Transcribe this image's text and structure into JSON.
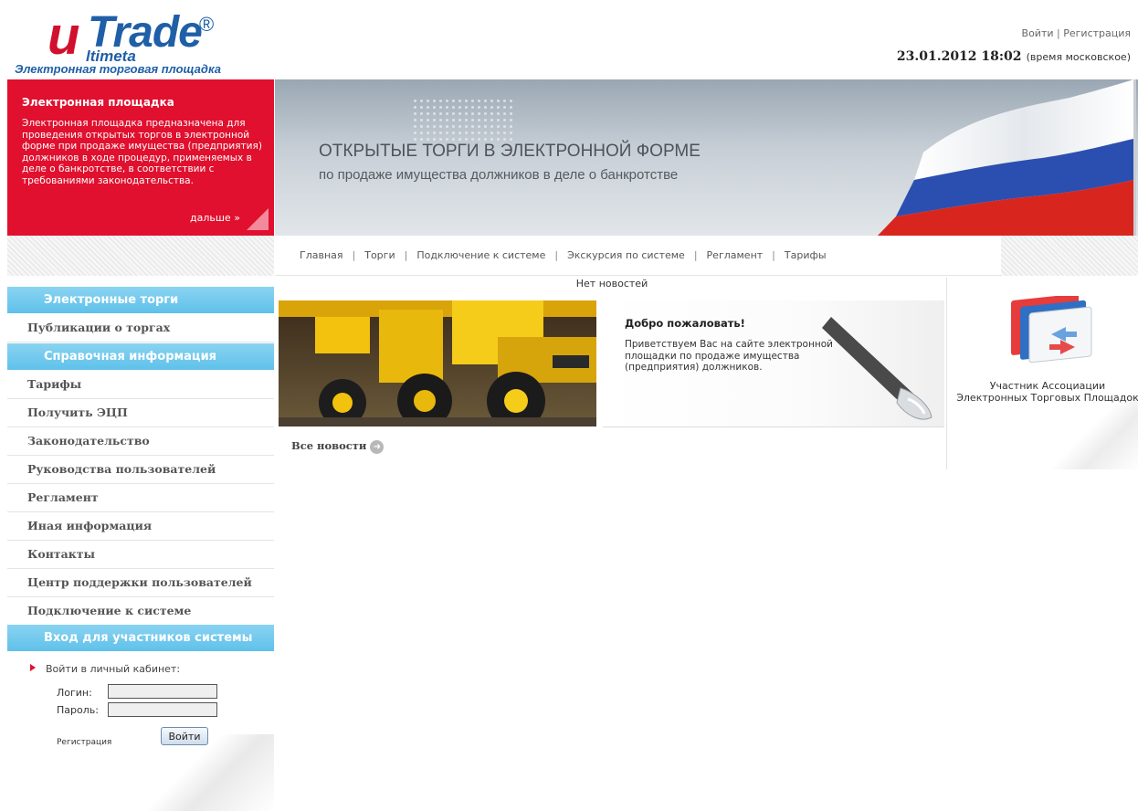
{
  "logo": {
    "brand_u": "u",
    "brand_trade": "Trade",
    "registered": "®",
    "sub_brand": "ltimeta",
    "tagline": "Электронная торговая площадка"
  },
  "header": {
    "login_link": "Войти",
    "link_separator": "|",
    "register_link": "Регистрация",
    "datetime": "23.01.2012 18:02",
    "timezone": "(время московское)"
  },
  "intro_box": {
    "title": "Электронная площадка",
    "text": "Электронная площадка предназначена для проведения открытых торгов в электронной форме при продаже имущества (предприятия) должников в ходе процедур, применяемых в деле о банкротстве, в соответствии с требованиями законодательства.",
    "more_link": "дальше »"
  },
  "banner": {
    "title": "ОТКРЫТЫЕ ТОРГИ В ЭЛЕКТРОННОЙ ФОРМЕ",
    "subtitle": "по продаже имущества должников в деле о банкротстве"
  },
  "nav": {
    "separator": "|",
    "items": [
      {
        "label": "Главная"
      },
      {
        "label": "Торги"
      },
      {
        "label": "Подключение к системе"
      },
      {
        "label": "Экскурсия по системе"
      },
      {
        "label": "Регламент"
      },
      {
        "label": "Тарифы"
      }
    ]
  },
  "sidebar": {
    "section_trading": "Электронные торги",
    "publications": "Публикации о торгах",
    "section_reference": "Справочная информация",
    "items": [
      {
        "label": "Тарифы"
      },
      {
        "label": "Получить ЭЦП"
      },
      {
        "label": "Законодательство"
      },
      {
        "label": "Руководства пользователей"
      },
      {
        "label": "Регламент"
      },
      {
        "label": "Иная информация"
      },
      {
        "label": "Контакты"
      },
      {
        "label": "Центр поддержки пользователей"
      },
      {
        "label": "Подключение к системе"
      }
    ],
    "section_login": "Вход для участников системы"
  },
  "login": {
    "caption": "Войти в личный кабинет:",
    "login_label": "Логин:",
    "login_value": "",
    "password_label": "Пароль:",
    "password_value": "",
    "register_link": "Регистрация",
    "submit_label": "Войти"
  },
  "news": {
    "empty_text": "Нет новостей",
    "welcome_title": "Добро пожаловать!",
    "welcome_text": "Приветствуем Вас на сайте электронной площадки по продаже имущества (предприятия) должников.",
    "all_news_link": "Все новости",
    "all_news_icon": "arrow-right-circle-icon"
  },
  "right_panel": {
    "assoc_text": "Участник Ассоциации Электронных Торговых Площадок"
  },
  "colors": {
    "brand_red": "#e0102e",
    "brand_blue": "#1f5fa8",
    "sidebar_header": "#5fc1ea"
  }
}
